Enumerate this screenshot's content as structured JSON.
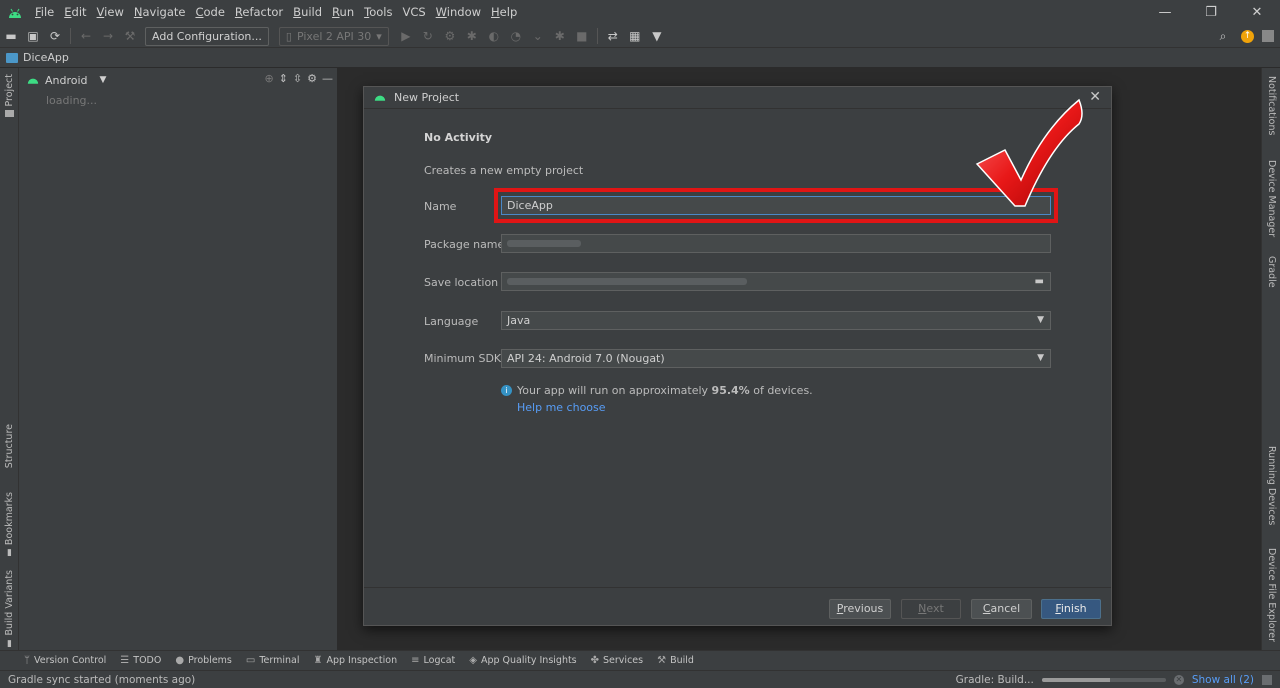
{
  "menu": [
    "File",
    "Edit",
    "View",
    "Navigate",
    "Code",
    "Refactor",
    "Build",
    "Run",
    "Tools",
    "VCS",
    "Window",
    "Help"
  ],
  "window_controls": {
    "minimize": "—",
    "restore": "❐",
    "close": "✕"
  },
  "toolbar": {
    "add_config": "Add Configuration...",
    "device": "Pixel 2 API 30"
  },
  "navbar": {
    "project": "DiceApp"
  },
  "left_stripe": {
    "project": "Project",
    "structure": "Structure",
    "bookmarks": "Bookmarks",
    "build_variants": "Build Variants"
  },
  "project_panel": {
    "view": "Android",
    "loading": "loading..."
  },
  "right_stripe": {
    "notifications": "Notifications",
    "device_manager": "Device Manager",
    "gradle": "Gradle",
    "running_devices": "Running Devices",
    "device_file_explorer": "Device File Explorer"
  },
  "dialog": {
    "title": "New Project",
    "template": "No Activity",
    "description": "Creates a new empty project",
    "name_label": "Name",
    "name_value": "DiceApp",
    "package_label": "Package name",
    "save_label": "Save location",
    "language_label": "Language",
    "language_value": "Java",
    "min_sdk_label": "Minimum SDK",
    "min_sdk_value": "API 24: Android 7.0 (Nougat)",
    "info_prefix": "Your app will run on approximately ",
    "info_percent": "95.4%",
    "info_suffix": " of devices.",
    "help_link": "Help me choose",
    "buttons": {
      "previous": "Previous",
      "next": "Next",
      "cancel": "Cancel",
      "finish": "Finish"
    }
  },
  "bottom_tabs": [
    "Version Control",
    "TODO",
    "Problems",
    "Terminal",
    "App Inspection",
    "Logcat",
    "App Quality Insights",
    "Services",
    "Build"
  ],
  "status": {
    "message": "Gradle sync started (moments ago)",
    "task": "Gradle: Build...",
    "show_all": "Show all (2)",
    "progress": 0.55
  },
  "colors": {
    "accent": "#365880",
    "link": "#589df6",
    "highlight": "#e01515",
    "android_green": "#3ddc84"
  }
}
